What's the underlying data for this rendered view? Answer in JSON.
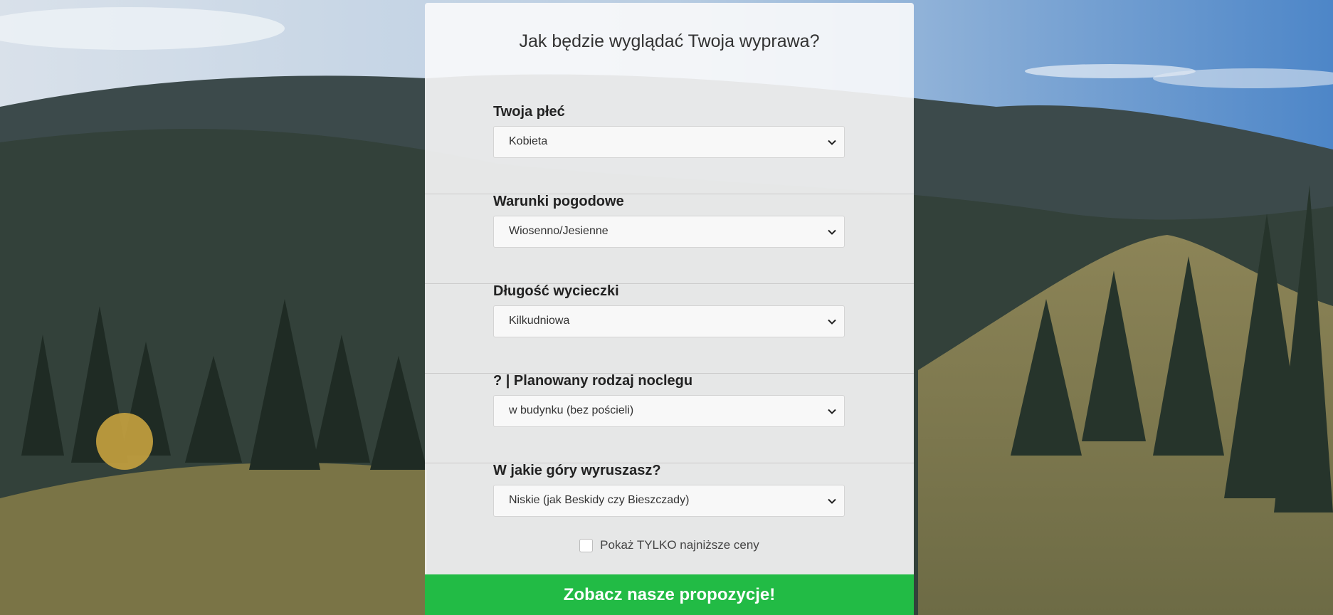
{
  "form": {
    "title": "Jak będzie wyglądać Twoja wyprawa?",
    "fields": [
      {
        "label": "Twoja płeć",
        "value": "Kobieta"
      },
      {
        "label": "Warunki pogodowe",
        "value": "Wiosenno/Jesienne"
      },
      {
        "label": "Długość wycieczki",
        "value": "Kilkudniowa"
      },
      {
        "label": "? | Planowany rodzaj noclegu",
        "value": "w budynku (bez pościeli)"
      },
      {
        "label": "W jakie góry wyruszasz?",
        "value": "Niskie (jak Beskidy czy Bieszczady)"
      }
    ],
    "checkbox_label": "Pokaż TYLKO najniższe ceny",
    "submit_label": "Zobacz nasze propozycje!"
  },
  "colors": {
    "accent": "#22bb45",
    "panel": "#fafafb"
  },
  "icons": {
    "select_arrow": "chevron-down-icon"
  }
}
